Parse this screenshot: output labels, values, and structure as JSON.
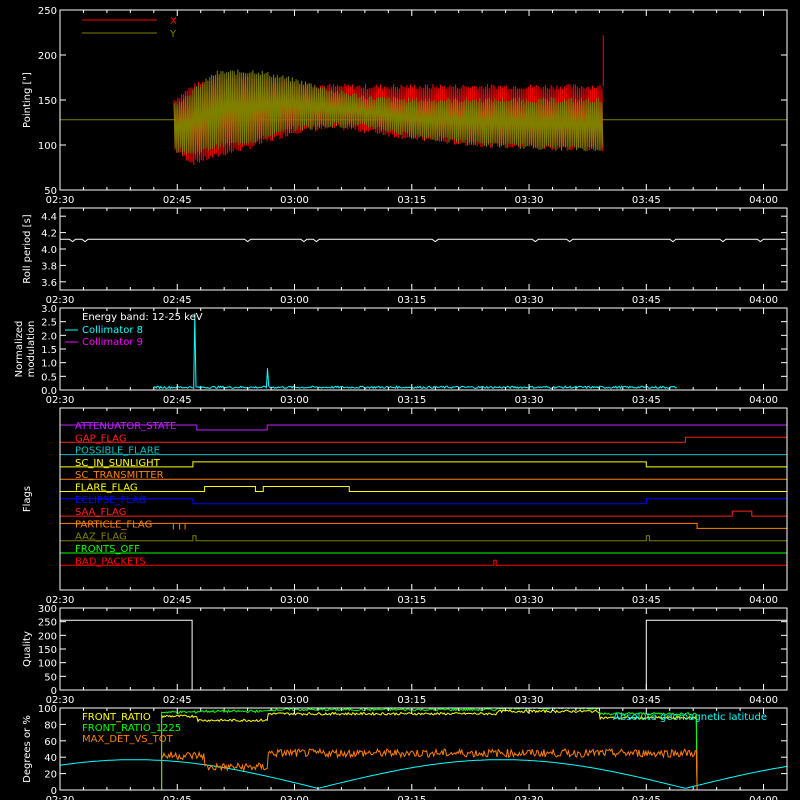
{
  "chart_data": [
    {
      "id": "pointing",
      "type": "line",
      "ylabel": "Pointing [\"]",
      "ylim": [
        50,
        250
      ],
      "yticks": [
        50,
        100,
        150,
        200,
        250
      ],
      "xticks": [
        "02:30",
        "02:45",
        "03:00",
        "03:15",
        "03:30",
        "03:45",
        "04:00"
      ],
      "xlim_minutes": [
        0,
        93
      ],
      "reference_line": 128,
      "series": [
        {
          "name": "X",
          "color": "#ff0000",
          "envelope_min": [
            [
              14.6,
              95
            ],
            [
              17,
              80
            ],
            [
              20,
              88
            ],
            [
              25,
              100
            ],
            [
              30,
              115
            ],
            [
              35,
              120
            ],
            [
              40,
              115
            ],
            [
              45,
              108
            ],
            [
              50,
              103
            ],
            [
              55,
              100
            ],
            [
              60,
              98
            ],
            [
              65,
              96
            ],
            [
              69.5,
              96
            ]
          ],
          "envelope_max": [
            [
              14.6,
              150
            ],
            [
              17,
              165
            ],
            [
              20,
              175
            ],
            [
              25,
              175
            ],
            [
              30,
              168
            ],
            [
              35,
              165
            ],
            [
              40,
              165
            ],
            [
              45,
              165
            ],
            [
              50,
              165
            ],
            [
              55,
              165
            ],
            [
              60,
              165
            ],
            [
              65,
              165
            ],
            [
              69.5,
              165
            ]
          ],
          "spike": [
            69.5,
            222
          ]
        },
        {
          "name": "Y",
          "color": "#808000",
          "envelope_min": [
            [
              14.6,
              95
            ],
            [
              17,
              90
            ],
            [
              20,
              98
            ],
            [
              25,
              105
            ],
            [
              30,
              118
            ],
            [
              35,
              122
            ],
            [
              40,
              120
            ],
            [
              45,
              110
            ],
            [
              50,
              105
            ],
            [
              55,
              100
            ],
            [
              60,
              98
            ],
            [
              65,
              96
            ],
            [
              69.5,
              96
            ]
          ],
          "envelope_max": [
            [
              14.6,
              145
            ],
            [
              17,
              160
            ],
            [
              20,
              180
            ],
            [
              25,
              182
            ],
            [
              30,
              172
            ],
            [
              35,
              160
            ],
            [
              40,
              152
            ],
            [
              45,
              150
            ],
            [
              50,
              150
            ],
            [
              55,
              150
            ],
            [
              60,
              150
            ],
            [
              65,
              150
            ],
            [
              69.5,
              150
            ]
          ]
        }
      ]
    },
    {
      "id": "roll",
      "type": "line",
      "ylabel": "Roll period [s]",
      "ylim": [
        3.5,
        4.5
      ],
      "yticks": [
        3.6,
        3.8,
        4.0,
        4.2,
        4.4
      ],
      "xticks": [
        "02:30",
        "02:45",
        "03:00",
        "03:15",
        "03:30",
        "03:45",
        "04:00"
      ],
      "series": [
        {
          "name": "",
          "color": "#ffffff",
          "value": 4.12
        }
      ]
    },
    {
      "id": "modulation",
      "type": "line",
      "ylabel": "Normalized modulation",
      "ylim": [
        0,
        3.0
      ],
      "yticks": [
        0.0,
        0.5,
        1.0,
        1.5,
        2.0,
        2.5,
        3.0
      ],
      "xticks": [
        "02:30",
        "02:45",
        "03:00",
        "03:15",
        "03:30",
        "03:45",
        "04:00"
      ],
      "annotation": "Energy band: 12-25 keV",
      "series": [
        {
          "name": "Collimator 8",
          "color": "#00ffff",
          "range": [
            12,
            79
          ],
          "baseline": 0.1,
          "spikes": [
            [
              17.2,
              2.8
            ],
            [
              26.5,
              0.8
            ]
          ]
        },
        {
          "name": "Collimator 9",
          "color": "#ff00ff",
          "value": 0.0
        }
      ]
    },
    {
      "id": "flags",
      "type": "line",
      "ylabel": "Flags",
      "xticks": [
        "02:30",
        "02:45",
        "03:00",
        "03:15",
        "03:30",
        "03:45",
        "04:00"
      ],
      "series": [
        {
          "name": "ATTENUATOR_STATE",
          "color": "#c020ff",
          "steps": [
            [
              0,
              1
            ],
            [
              17.5,
              0
            ],
            [
              26.5,
              1
            ]
          ]
        },
        {
          "name": "GAP_FLAG",
          "color": "#ff2020",
          "steps": [
            [
              0,
              0
            ],
            [
              80,
              1
            ]
          ]
        },
        {
          "name": "POSSIBLE_FLARE",
          "color": "#00c0c0",
          "steps": [
            [
              0,
              0
            ]
          ]
        },
        {
          "name": "SC_IN_SUNLIGHT",
          "color": "#ffff00",
          "steps": [
            [
              0,
              0
            ],
            [
              17,
              1
            ],
            [
              75,
              0
            ]
          ]
        },
        {
          "name": "SC_TRANSMITTER",
          "color": "#ff8000",
          "steps": [
            [
              0,
              0
            ]
          ]
        },
        {
          "name": "FLARE_FLAG",
          "color": "#ffff00",
          "steps": [
            [
              0,
              0
            ],
            [
              18.5,
              1
            ],
            [
              25,
              0
            ],
            [
              26,
              1
            ],
            [
              37,
              0
            ]
          ]
        },
        {
          "name": "ECLIPSE_FLAG",
          "color": "#0000ff",
          "steps": [
            [
              0,
              1
            ],
            [
              17,
              0
            ],
            [
              75,
              1
            ]
          ]
        },
        {
          "name": "SAA_FLAG",
          "color": "#ff2020",
          "steps": [
            [
              0,
              0
            ],
            [
              86,
              1
            ],
            [
              88.5,
              0
            ]
          ]
        },
        {
          "name": "PARTICLE_FLAG",
          "color": "#ff8000",
          "steps": [
            [
              0,
              1
            ],
            [
              81.5,
              0
            ]
          ]
        },
        {
          "name": "AAZ_FLAG",
          "color": "#808000",
          "steps": [
            [
              0,
              0
            ],
            [
              17,
              1
            ],
            [
              17.4,
              0
            ],
            [
              75,
              1
            ],
            [
              75.4,
              0
            ]
          ]
        },
        {
          "name": "FRONTS_OFF",
          "color": "#00ff00",
          "steps": [
            [
              0,
              0
            ]
          ]
        },
        {
          "name": "BAD_PACKETS",
          "color": "#ff0000",
          "steps": [
            [
              0,
              0
            ],
            [
              55.5,
              1
            ],
            [
              55.8,
              0
            ]
          ]
        }
      ]
    },
    {
      "id": "quality",
      "type": "line",
      "ylabel": "Quality",
      "ylim": [
        0,
        300
      ],
      "yticks": [
        0,
        50,
        100,
        150,
        200,
        250,
        300
      ],
      "xticks": [
        "02:30",
        "02:45",
        "03:00",
        "03:15",
        "03:30",
        "03:45",
        "04:00"
      ],
      "series": [
        {
          "name": "",
          "color": "#ffffff",
          "steps": [
            [
              0,
              255
            ],
            [
              16.9,
              0
            ],
            [
              75,
              255
            ]
          ]
        }
      ]
    },
    {
      "id": "ratios",
      "type": "line",
      "ylabel": "Degrees or %",
      "ylim": [
        0,
        100
      ],
      "yticks": [
        0,
        20,
        40,
        60,
        80,
        100
      ],
      "xticks": [
        "02:30",
        "02:45",
        "03:00",
        "03:15",
        "03:30",
        "03:45",
        "04:00"
      ],
      "series": [
        {
          "name": "FRONT_RATIO",
          "color": "#ffff00",
          "range": [
            13,
            81.5
          ],
          "levels": [
            [
              13,
              90
            ],
            [
              17.5,
              85
            ],
            [
              26.5,
              93
            ],
            [
              56,
              96
            ],
            [
              69,
              88
            ],
            [
              81.5,
              88
            ]
          ]
        },
        {
          "name": "FRONT_RATIO_1225",
          "color": "#00ff00",
          "range": [
            13,
            81.5
          ],
          "levels": [
            [
              13,
              95
            ],
            [
              17.5,
              96
            ],
            [
              26.5,
              98
            ],
            [
              56,
              100
            ],
            [
              69,
              93
            ],
            [
              81.5,
              93
            ]
          ]
        },
        {
          "name": "MAX_DET_VS_TOT",
          "color": "#ff8000",
          "range": [
            13,
            81.5
          ],
          "levels": [
            [
              13,
              42
            ],
            [
              18.5,
              28
            ],
            [
              26.5,
              45
            ],
            [
              56,
              45
            ],
            [
              81.5,
              45
            ]
          ]
        },
        {
          "name": "Absolute geomagnetic latitude",
          "color": "#00ffff"
        }
      ]
    }
  ]
}
